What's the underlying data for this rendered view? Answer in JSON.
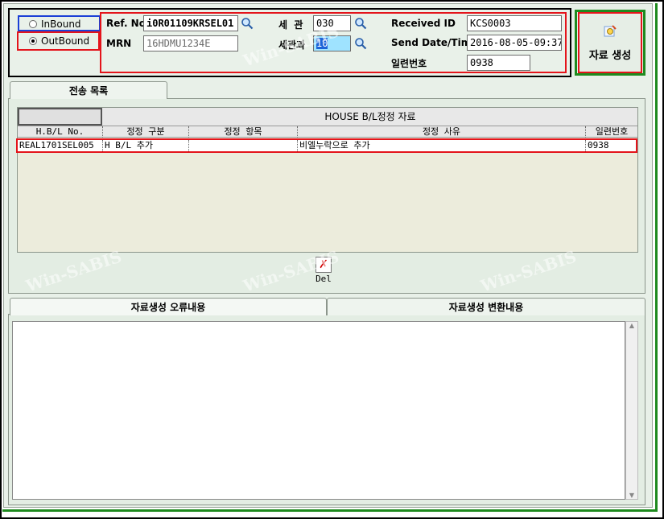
{
  "direction": {
    "inbound_label": "InBound",
    "outbound_label": "OutBound",
    "selected": "OutBound"
  },
  "ref_no": {
    "label": "Ref. No.",
    "value": "i0R01109KRSEL01"
  },
  "mrn": {
    "label": "MRN",
    "value": "16HDMU1234E"
  },
  "customs": {
    "label": "세  관",
    "value": "030"
  },
  "customs_dept": {
    "label": "세관과",
    "value": "10"
  },
  "received_id": {
    "label": "Received ID",
    "value": "KCS0003"
  },
  "send_datetime": {
    "label": "Send Date/Time",
    "value": "2016-08-05-09:37"
  },
  "serial_no": {
    "label": "일련번호",
    "value": "0938"
  },
  "generate_button": {
    "label": "자료 생성"
  },
  "list_tab": {
    "label": "전송 목록"
  },
  "grid": {
    "title": "HOUSE B/L정정 자료",
    "columns": [
      "H.B/L No.",
      "정정 구분",
      "정정 항목",
      "정정 사유",
      "일련번호"
    ],
    "rows": [
      [
        "REAL1701SEL005",
        "H B/L 추가",
        "",
        "비엘누락으로 추가",
        "0938"
      ]
    ]
  },
  "delete_button": {
    "label": "Del"
  },
  "bottom_tabs": {
    "errors_label": "자료생성 오류내용",
    "conversion_label": "자료생성 변환내용"
  },
  "watermark": "Win-SABIS",
  "colors": {
    "highlight_red": "#e4141b",
    "frame_green": "#1e8a1e",
    "panel_bg": "#e3ede3",
    "selected_field": "#9fe3ff"
  }
}
